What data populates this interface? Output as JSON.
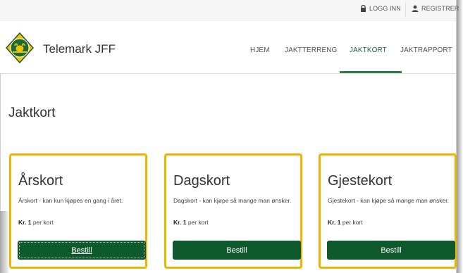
{
  "topbar": {
    "login_label": "LOGG INN",
    "register_label": "REGISTRER"
  },
  "header": {
    "brand": "Telemark JFF",
    "nav": [
      {
        "label": "HJEM",
        "active": false
      },
      {
        "label": "JAKTTERRENG",
        "active": false
      },
      {
        "label": "JAKTKORT",
        "active": true
      },
      {
        "label": "JAKTRAPPORT",
        "active": false
      }
    ]
  },
  "main": {
    "title": "Jaktkort",
    "cards": [
      {
        "title": "Årskort",
        "description": "Årskort - kan kun kjøpes en gang i året.",
        "price_label": "Kr. 1",
        "price_suffix": "per kort",
        "button": "Bestill"
      },
      {
        "title": "Dagskort",
        "description": "Dagskort - kan kjøpe så mange man ønsker.",
        "price_label": "Kr. 1",
        "price_suffix": "per kort",
        "button": "Bestill"
      },
      {
        "title": "Gjestekort",
        "description": "Gjestekort - kan kjøpe så mange man ønsker.",
        "price_label": "Kr. 1",
        "price_suffix": "per kort",
        "button": "Bestill"
      }
    ]
  },
  "colors": {
    "accent_green": "#0f5a2d",
    "highlight_yellow": "#f0b400",
    "active_nav": "#2e7d47"
  },
  "icons": {
    "login": "lock-icon",
    "register": "user-icon",
    "logo": "logo-icon"
  }
}
